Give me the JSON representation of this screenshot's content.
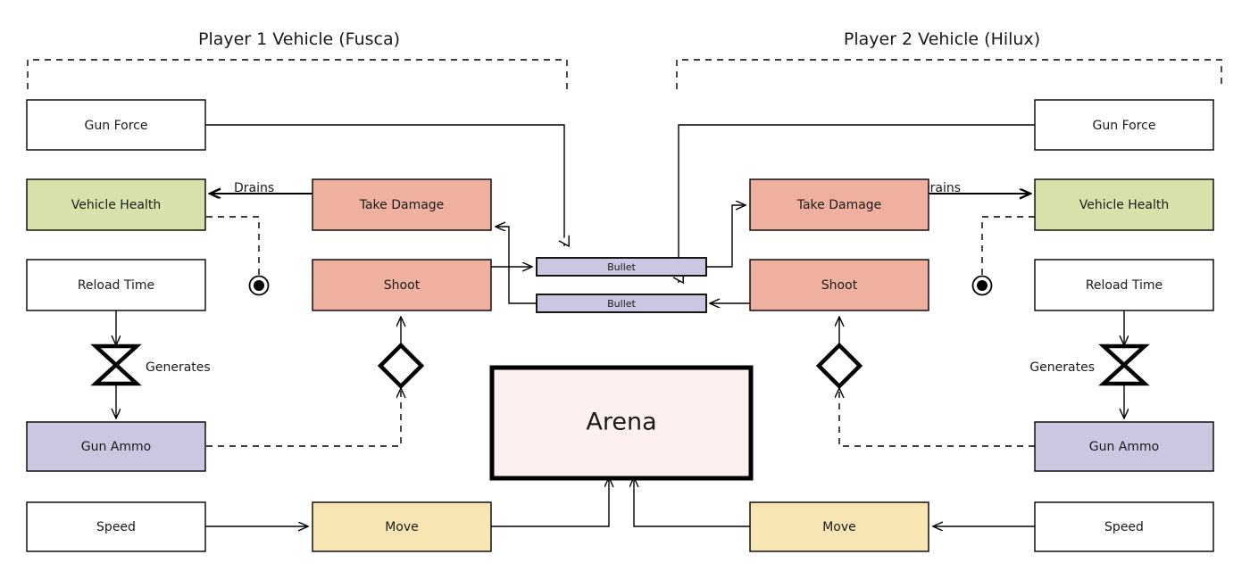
{
  "diagram": {
    "title_left": "Player 1 Vehicle (Fusca)",
    "title_right": "Player 2 Vehicle (Hilux)",
    "center": {
      "arena_label": "Arena"
    },
    "edge_labels": {
      "drains_left": "Drains",
      "drains_right": "Drains",
      "generates_left": "Generates",
      "generates_right": "Generates"
    },
    "left": {
      "gun_force": "Gun Force",
      "vehicle_health": "Vehicle Health",
      "take_damage": "Take Damage",
      "reload_time": "Reload Time",
      "shoot": "Shoot",
      "gun_ammo": "Gun Ammo",
      "speed": "Speed",
      "move": "Move",
      "bullet": "Bullet"
    },
    "right": {
      "gun_force": "Gun Force",
      "vehicle_health": "Vehicle Health",
      "take_damage": "Take Damage",
      "reload_time": "Reload Time",
      "shoot": "Shoot",
      "gun_ammo": "Gun Ammo",
      "speed": "Speed",
      "move": "Move",
      "bullet": "Bullet"
    },
    "colors": {
      "resource_green": "#d6e2aa",
      "action_salmon": "#efb0a0",
      "pool_purple": "#ccc6e0",
      "move_yellow": "#f8e5b4",
      "arena_pink": "#fdf0ee",
      "plain_white": "#ffffff",
      "stroke": "#000000"
    },
    "icons": {
      "converter_left": "converter-bowtie-icon",
      "converter_right": "converter-bowtie-icon",
      "gate_left": "gate-diamond-icon",
      "gate_right": "gate-diamond-icon",
      "end_condition_left": "end-condition-circle-icon",
      "end_condition_right": "end-condition-circle-icon"
    }
  }
}
